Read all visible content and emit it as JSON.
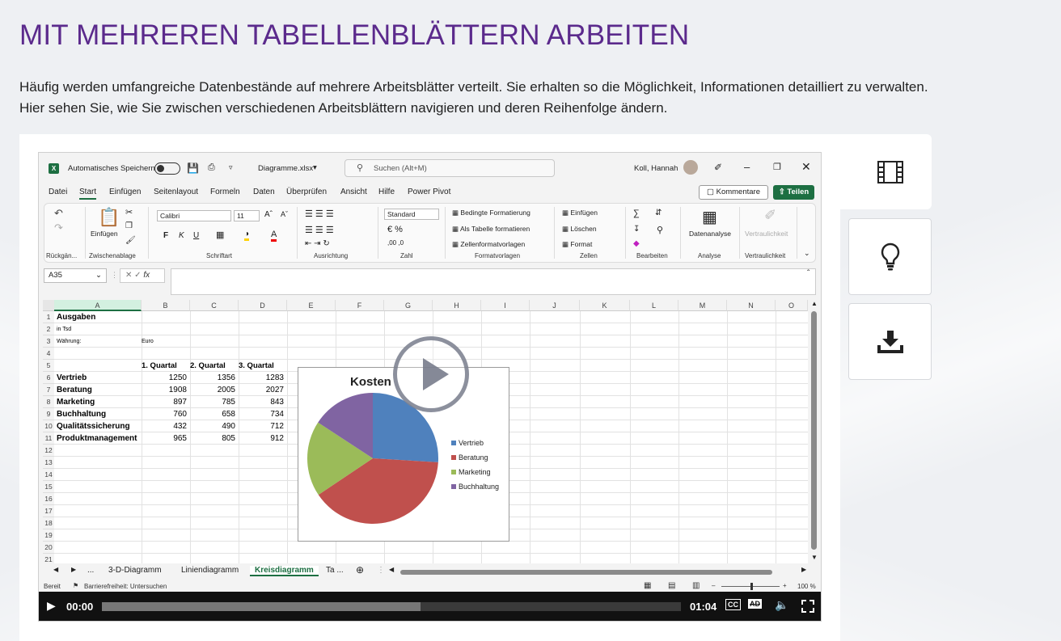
{
  "page": {
    "title": "MIT MEHREREN TABELLENBLÄTTERN ARBEITEN",
    "intro": "Häufig werden umfangreiche Datenbestände auf mehrere Arbeitsblätter verteilt. Sie erhalten so die Möglichkeit, Informationen detailliert zu verwalten. Hier sehen Sie, wie Sie zwischen verschiedenen Arbeitsblättern navigieren und deren Reihenfolge ändern."
  },
  "sidebar": {
    "icons": [
      "film-icon",
      "lightbulb-icon",
      "download-icon"
    ]
  },
  "excel": {
    "autosave_label": "Automatisches Speichern",
    "filename": "Diagramme.xlsx",
    "search_placeholder": "Suchen (Alt+M)",
    "user": "Koll, Hannah",
    "menu": [
      "Datei",
      "Start",
      "Einfügen",
      "Seitenlayout",
      "Formeln",
      "Daten",
      "Überprüfen",
      "Ansicht",
      "Hilfe",
      "Power Pivot"
    ],
    "kommentare": "Kommentare",
    "teilen": "Teilen",
    "ribbon": {
      "einfuegen": "Einfügen",
      "font": "Calibri",
      "size": "11",
      "fmt_number": "Standard",
      "bedingte": "Bedingte Formatierung",
      "als_tabelle": "Als Tabelle formatieren",
      "zellenformat": "Zellenformatvorlagen",
      "z_einfuegen": "Einfügen",
      "z_loeschen": "Löschen",
      "z_format": "Format",
      "datenanalyse": "Datenanalyse",
      "vertraulichkeit": "Vertraulichkeit",
      "groups": [
        "Rückgän...",
        "Zwischenablage",
        "Schriftart",
        "Ausrichtung",
        "Zahl",
        "Formatvorlagen",
        "Zellen",
        "Bearbeiten",
        "Analyse",
        "Vertraulichkeit"
      ]
    },
    "namebox": "A35",
    "columns": [
      "A",
      "B",
      "C",
      "D",
      "E",
      "F",
      "G",
      "H",
      "I",
      "J",
      "K",
      "L",
      "M",
      "N",
      "O"
    ],
    "rows": [
      "1",
      "2",
      "3",
      "4",
      "5",
      "6",
      "7",
      "8",
      "9",
      "10",
      "11",
      "12",
      "13",
      "14",
      "15",
      "16",
      "17",
      "18",
      "19",
      "20",
      "21"
    ],
    "cells": {
      "a1": "Ausgaben",
      "a2": "in Tsd",
      "a3": "Währung:",
      "b3": "Euro",
      "b5": "1. Quartal",
      "c5": "2. Quartal",
      "d5": "3. Quartal"
    },
    "table": [
      {
        "name": "Vertrieb",
        "q1": "1250",
        "q2": "1356",
        "q3": "1283"
      },
      {
        "name": "Beratung",
        "q1": "1908",
        "q2": "2005",
        "q3": "2027"
      },
      {
        "name": "Marketing",
        "q1": "897",
        "q2": "785",
        "q3": "843"
      },
      {
        "name": "Buchhaltung",
        "q1": "760",
        "q2": "658",
        "q3": "734"
      },
      {
        "name": "Qualitätssicherung",
        "q1": "432",
        "q2": "490",
        "q3": "712"
      },
      {
        "name": "Produktmanagement",
        "q1": "965",
        "q2": "805",
        "q3": "912"
      }
    ],
    "sheet_tabs": [
      "...",
      "3-D-Diagramm",
      "Liniendiagramm",
      "Kreisdiagramm",
      "Ta ..."
    ],
    "active_tab": "Kreisdiagramm",
    "status_left": "Bereit",
    "status_access": "Barrierefreiheit: Untersuchen",
    "zoom": "100 %"
  },
  "chart_data": {
    "type": "pie",
    "title": "Kosten",
    "categories": [
      "Vertrieb",
      "Beratung",
      "Marketing",
      "Buchhaltung"
    ],
    "values": [
      1250,
      1908,
      897,
      760
    ],
    "colors": [
      "#4f81bd",
      "#c0504d",
      "#9bbb59",
      "#8064a2"
    ],
    "legend": "right"
  },
  "player": {
    "current_time": "00:00",
    "duration": "01:04",
    "progress": 0.55
  }
}
